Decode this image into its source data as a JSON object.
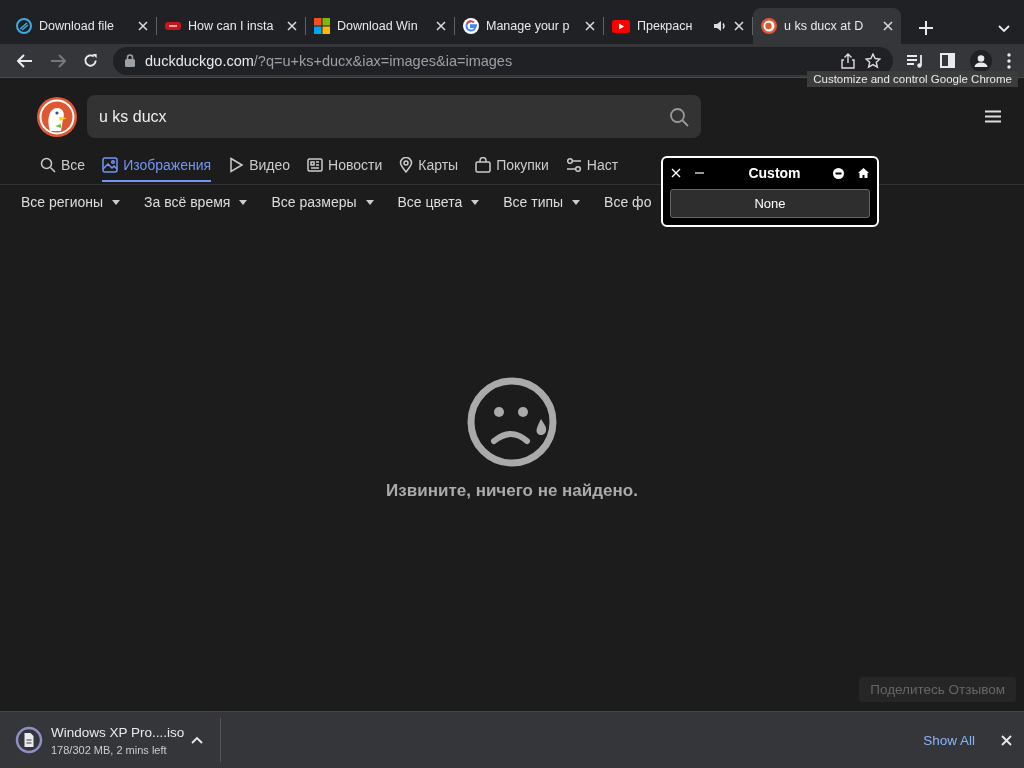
{
  "browser": {
    "tabs": [
      {
        "title": "Download file",
        "kind": "swirl",
        "selected": false,
        "audio": false
      },
      {
        "title": "How can I insta",
        "kind": "red",
        "selected": false,
        "audio": false
      },
      {
        "title": "Download Win",
        "kind": "windows",
        "selected": false,
        "audio": false
      },
      {
        "title": "Manage your p",
        "kind": "google",
        "selected": false,
        "audio": false
      },
      {
        "title": "Прекрасн",
        "kind": "youtube",
        "selected": false,
        "audio": true
      },
      {
        "title": "u ks ducx at D",
        "kind": "duck",
        "selected": true,
        "audio": false
      }
    ],
    "url_host": "duckduckgo.com",
    "url_path": "/?q=u+ks+ducx&iax=images&ia=images",
    "tooltip": "Customize and control Google Chrome"
  },
  "search": {
    "value": "u ks ducx"
  },
  "nav": [
    {
      "label": "Все",
      "kind": "search",
      "selected": false
    },
    {
      "label": "Изображения",
      "kind": "image",
      "selected": true
    },
    {
      "label": "Видео",
      "kind": "play",
      "selected": false
    },
    {
      "label": "Новости",
      "kind": "news",
      "selected": false
    },
    {
      "label": "Карты",
      "kind": "pin",
      "selected": false
    },
    {
      "label": "Покупки",
      "kind": "bag",
      "selected": false
    },
    {
      "label": "Наст",
      "kind": "sliders",
      "selected": false
    }
  ],
  "filters": [
    "Все регионы",
    "За всё время",
    "Все размеры",
    "Все цвета",
    "Все типы",
    "Все фо"
  ],
  "empty_message": "Извините, ничего не найдено.",
  "feedback": "Поделитесь Отзывом",
  "popup": {
    "title": "Custom",
    "button": "None"
  },
  "download": {
    "file": "Windows XP Pro....iso",
    "status": "178/302 MB, 2 mins left",
    "show_all": "Show All"
  }
}
